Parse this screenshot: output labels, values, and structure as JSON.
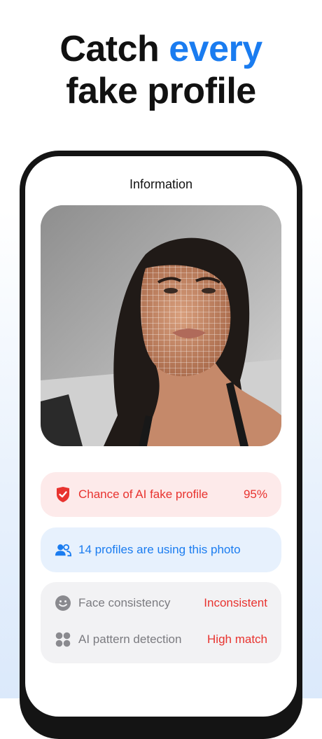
{
  "headline": {
    "line1_plain": "Catch ",
    "line1_accent": "every",
    "line2": "fake profile"
  },
  "screen": {
    "title": "Information"
  },
  "photo": {
    "alt": "selfie with face-mesh overlay"
  },
  "ai_chance": {
    "label": "Chance of AI fake profile",
    "value": "95%",
    "icon": "shield-check-icon"
  },
  "profiles": {
    "label": "14 profiles are using this photo",
    "icon": "people-icon"
  },
  "checks": [
    {
      "label": "Face consistency",
      "value": "Inconsistent",
      "icon": "smiley-icon"
    },
    {
      "label": "AI pattern detection",
      "value": "High match",
      "icon": "dots-grid-icon"
    }
  ],
  "colors": {
    "accent": "#1a7cf0",
    "danger": "#e8332f",
    "danger_bg": "#fdeaea",
    "info_bg": "#e7f1fd",
    "neutral_bg": "#f2f2f4"
  }
}
